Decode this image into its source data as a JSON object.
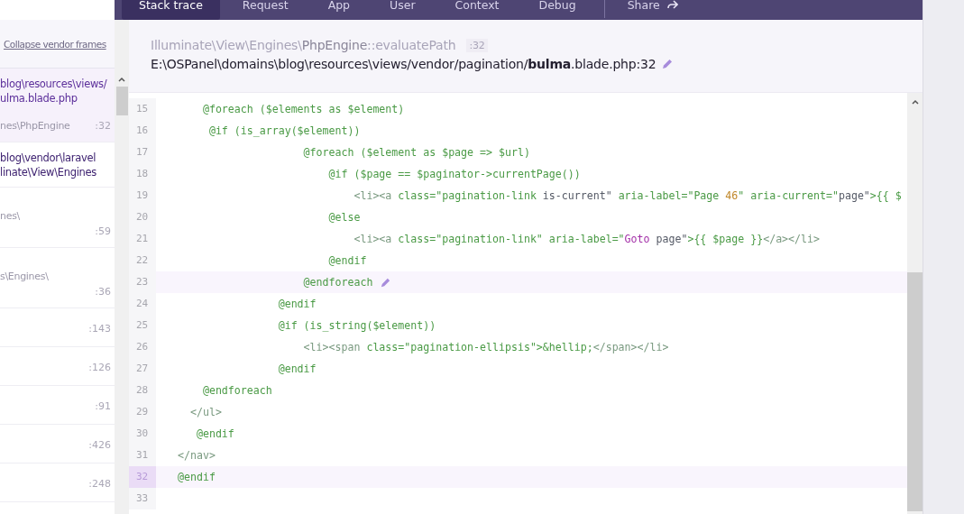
{
  "tabs": [
    {
      "label": "Stack trace",
      "selected": true
    },
    {
      "label": "Request",
      "selected": false
    },
    {
      "label": "App",
      "selected": false
    },
    {
      "label": "User",
      "selected": false
    },
    {
      "label": "Context",
      "selected": false
    },
    {
      "label": "Debug",
      "selected": false
    }
  ],
  "share": {
    "label": "Share"
  },
  "sidebar": {
    "collapse_link": "Collapse vendor frames",
    "frames": [
      {
        "selected": true,
        "path": [
          "blog\\resources\\views/",
          "ulma.blade.php"
        ],
        "class": "nes\\PhpEngine",
        "line": ":32"
      },
      {
        "selected": false,
        "path": [
          "blog\\vendor\\laravel",
          "linate\\View\\Engines"
        ]
      },
      {
        "selected": false,
        "class": "nes\\",
        "line": ":59"
      },
      {
        "selected": false,
        "class": "s\\Engines\\",
        "line": ":36"
      },
      {
        "selected": false,
        "line": ":143"
      },
      {
        "selected": false,
        "line": ":126"
      },
      {
        "selected": false,
        "line": ":91"
      },
      {
        "selected": false,
        "line": ":426"
      },
      {
        "selected": false,
        "line": ":248"
      }
    ]
  },
  "frame_header": {
    "namespace": "Illuminate\\View\\Engines\\",
    "class": "PhpEngine",
    "method": "::evaluatePath",
    "line": ":32",
    "path": "E:\\OSPanel\\domains\\blog\\resources\\views/vendor/pagination/**bulma**.blade.php:32"
  },
  "code": {
    "lines": [
      {
        "number": "15",
        "selected": false,
        "edit": false,
        "parts": [
          {
            "kind": "code",
            "text": "    @foreach ($elements as $element)"
          }
        ]
      },
      {
        "number": "16",
        "selected": false,
        "edit": false,
        "parts": [
          {
            "kind": "code",
            "text": "     @if (is_array($element))"
          }
        ]
      },
      {
        "number": "17",
        "selected": false,
        "edit": false,
        "parts": [
          {
            "kind": "code",
            "text": "                    @foreach ($element as $page => $url)"
          }
        ]
      },
      {
        "number": "18",
        "selected": false,
        "edit": false,
        "parts": [
          {
            "kind": "code",
            "text": "                        @if ($page == $paginator->currentPage())"
          }
        ]
      },
      {
        "number": "19",
        "selected": false,
        "edit": false,
        "parts": [
          {
            "kind": "tag",
            "text": "                            <li><a "
          },
          {
            "kind": "code",
            "text": "class=\"pagination-link "
          },
          {
            "kind": "plain",
            "text": "is-current\" "
          },
          {
            "kind": "code",
            "text": "aria-label=\"Page "
          },
          {
            "kind": "num",
            "text": "46"
          },
          {
            "kind": "code",
            "text": "\" aria-current=\""
          },
          {
            "kind": "plain",
            "text": "page\""
          },
          {
            "kind": "code",
            "text": ">{{ $"
          }
        ]
      },
      {
        "number": "20",
        "selected": false,
        "edit": false,
        "parts": [
          {
            "kind": "code",
            "text": "                        @else"
          }
        ]
      },
      {
        "number": "21",
        "selected": false,
        "edit": false,
        "parts": [
          {
            "kind": "tag",
            "text": "                            <li><a "
          },
          {
            "kind": "code",
            "text": "class=\"pagination-link\" aria-label=\""
          },
          {
            "kind": "kw",
            "text": "Goto"
          },
          {
            "kind": "plain",
            "text": " page\""
          },
          {
            "kind": "code",
            "text": ">{{ $page }}"
          },
          {
            "kind": "tag",
            "text": "</a></li>"
          }
        ]
      },
      {
        "number": "22",
        "selected": false,
        "edit": false,
        "parts": [
          {
            "kind": "code",
            "text": "                        @endif"
          }
        ]
      },
      {
        "number": "23",
        "selected": false,
        "edit": true,
        "parts": [
          {
            "kind": "code",
            "text": "                    @endforeach"
          }
        ]
      },
      {
        "number": "24",
        "selected": false,
        "edit": false,
        "parts": [
          {
            "kind": "code",
            "text": "                @endif"
          }
        ]
      },
      {
        "number": "25",
        "selected": false,
        "edit": false,
        "parts": [
          {
            "kind": "code",
            "text": "                @if (is_string($element))"
          }
        ]
      },
      {
        "number": "26",
        "selected": false,
        "edit": false,
        "parts": [
          {
            "kind": "tag",
            "text": "                    <li><span "
          },
          {
            "kind": "code",
            "text": "class=\"pagination-ellipsis\">&hellip;"
          },
          {
            "kind": "tag",
            "text": "</span></li>"
          }
        ]
      },
      {
        "number": "27",
        "selected": false,
        "edit": false,
        "parts": [
          {
            "kind": "code",
            "text": "                @endif"
          }
        ]
      },
      {
        "number": "28",
        "selected": false,
        "edit": false,
        "parts": [
          {
            "kind": "code",
            "text": "    @endforeach"
          }
        ]
      },
      {
        "number": "29",
        "selected": false,
        "edit": false,
        "parts": [
          {
            "kind": "tag",
            "text": "  </ul>"
          }
        ]
      },
      {
        "number": "30",
        "selected": false,
        "edit": false,
        "parts": [
          {
            "kind": "code",
            "text": "   @endif"
          }
        ]
      },
      {
        "number": "31",
        "selected": false,
        "edit": false,
        "parts": [
          {
            "kind": "tag",
            "text": "</nav>"
          }
        ]
      },
      {
        "number": "32",
        "selected": true,
        "edit": false,
        "parts": [
          {
            "kind": "code",
            "text": "@endif"
          }
        ]
      },
      {
        "number": "33",
        "selected": false,
        "edit": false
      }
    ]
  }
}
